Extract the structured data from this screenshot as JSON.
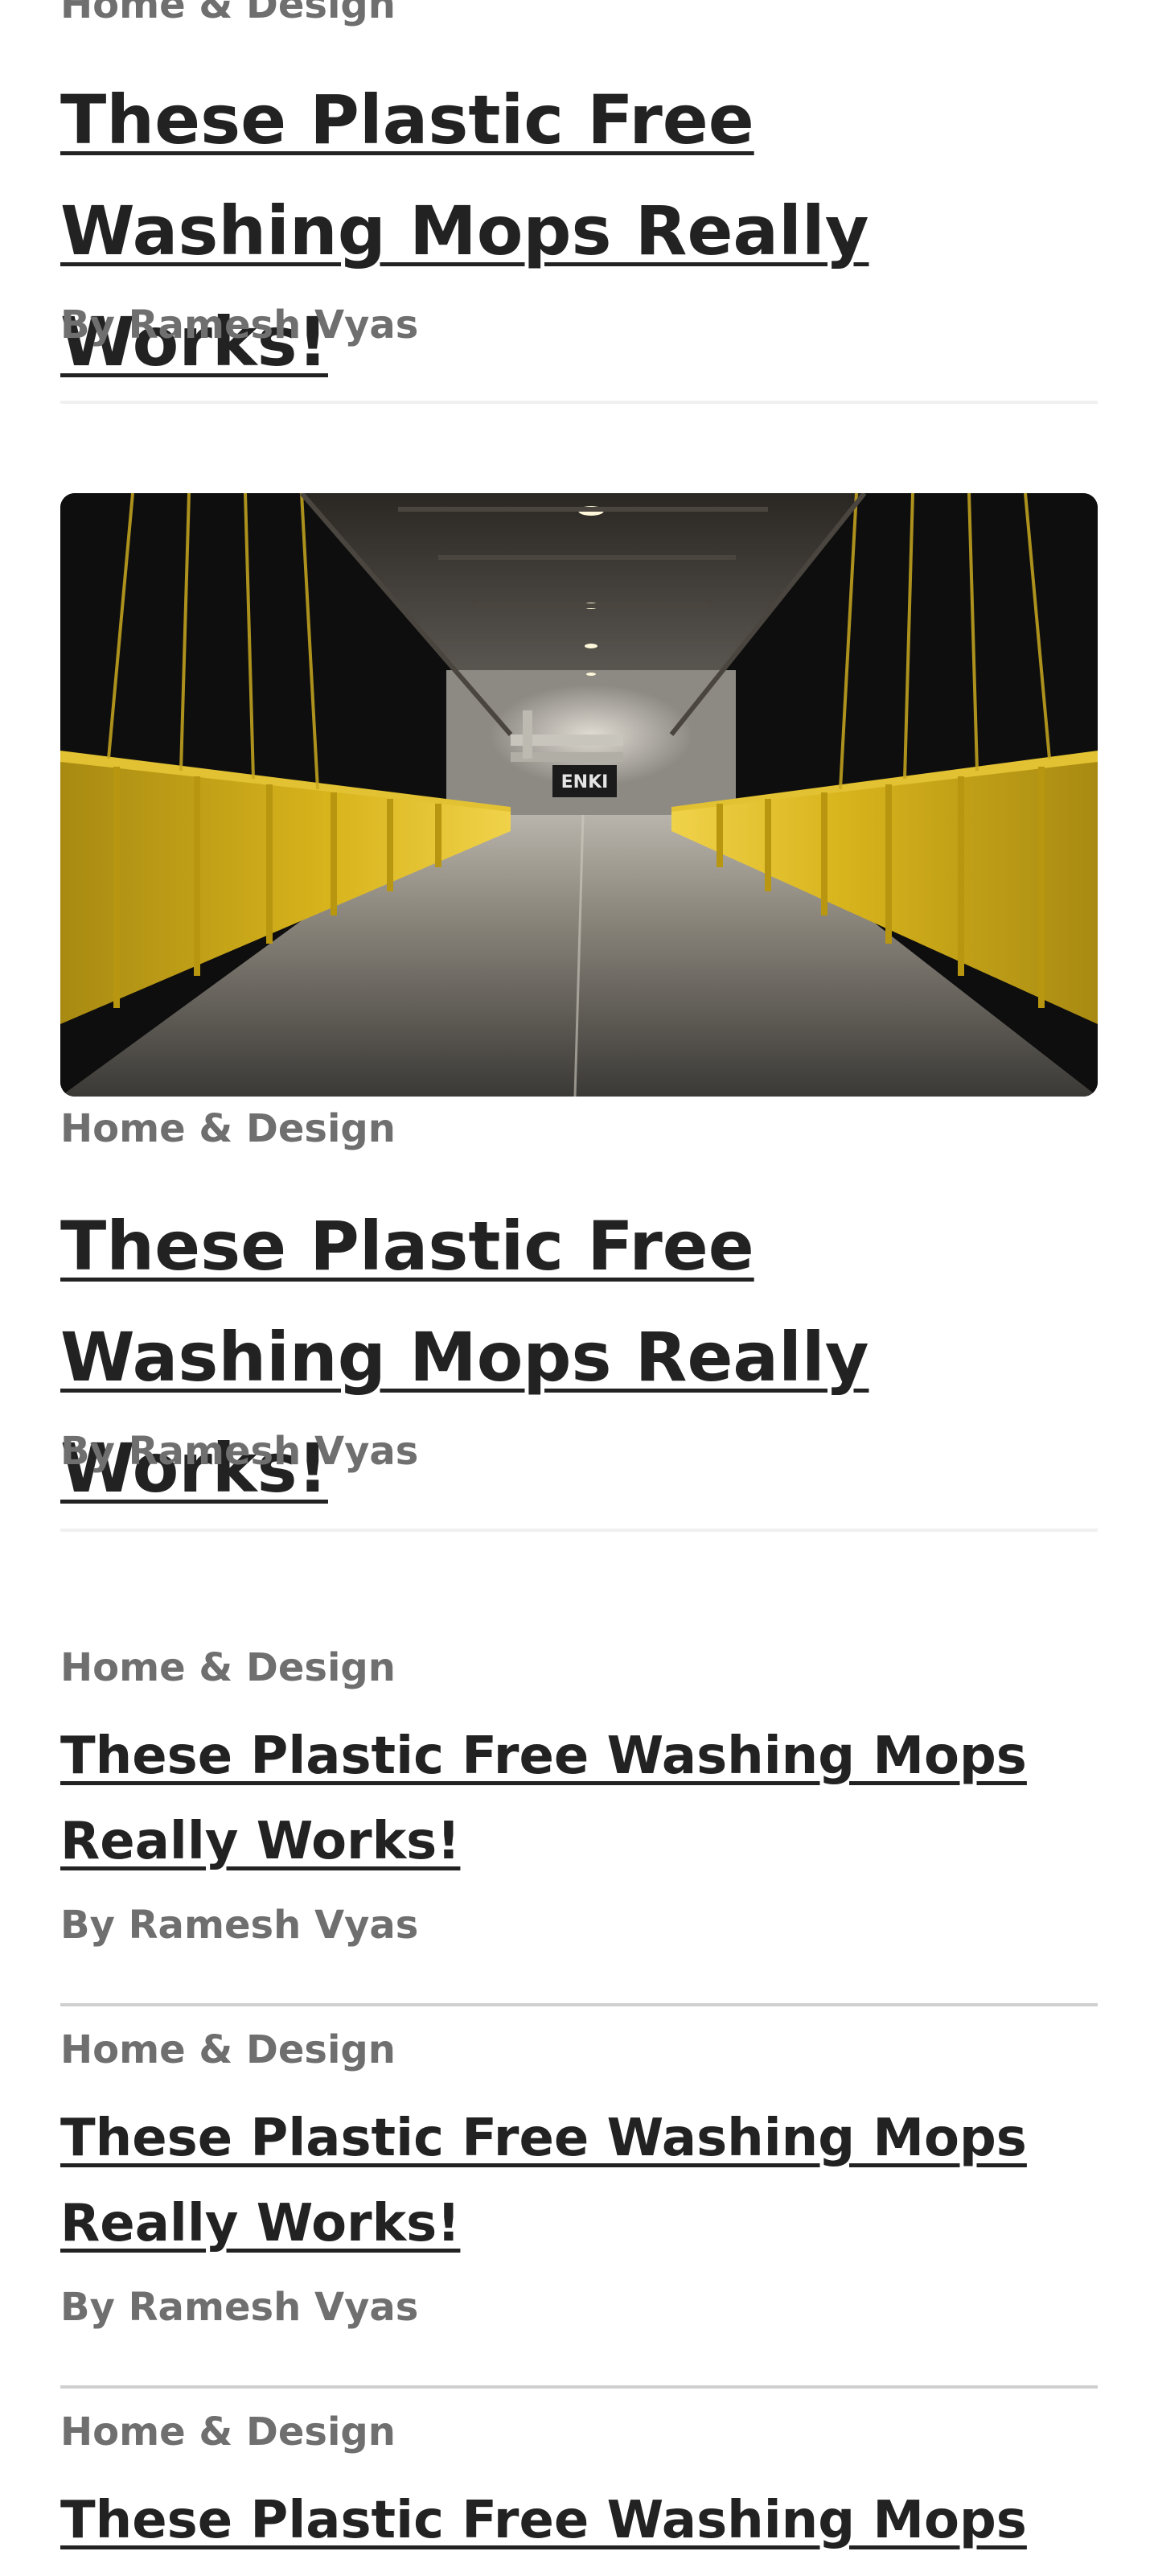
{
  "articles": [
    {
      "category": "Home & Design",
      "title": "These Plastic Free Washing Mops Really Works!",
      "author": "By Ramesh Vyas"
    },
    {
      "category": "Home & Design",
      "title": "These Plastic Free Washing Mops Really Works!",
      "author": "By Ramesh Vyas",
      "image_alt": "Yellow-railed pedestrian bridge inside an industrial hall",
      "image_sign": "ENKI"
    },
    {
      "category": "Home & Design",
      "title": "These Plastic Free Washing Mops Really Works!",
      "author": "By Ramesh Vyas"
    },
    {
      "category": "Home & Design",
      "title": "These Plastic Free Washing Mops Really Works!",
      "author": "By Ramesh Vyas"
    },
    {
      "category": "Home & Design",
      "title": "These Plastic Free Washing Mops",
      "author": ""
    }
  ],
  "colors": {
    "text": "#222222",
    "muted": "#6f6f6f",
    "divider_light": "#f0f0f0",
    "divider": "#cfcfcf",
    "railing": "#d8b41c"
  }
}
